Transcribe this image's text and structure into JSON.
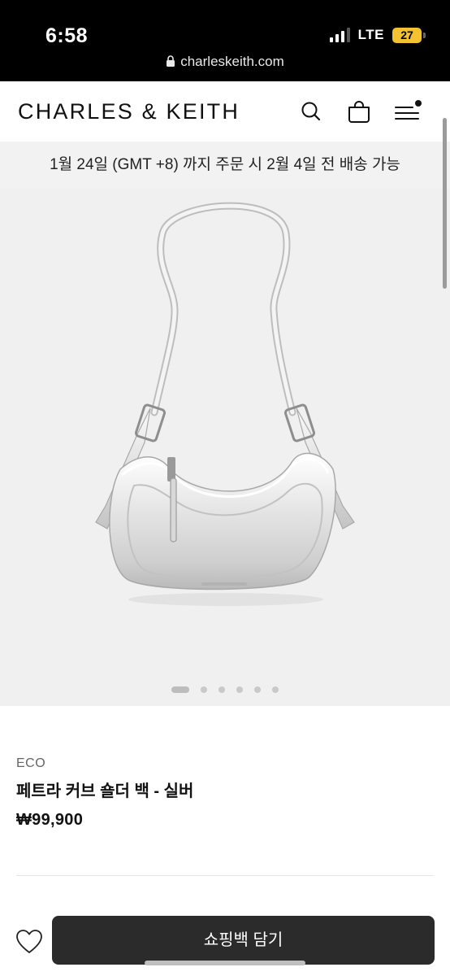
{
  "status_bar": {
    "time": "6:58",
    "network": "LTE",
    "battery": "27"
  },
  "browser": {
    "url": "charleskeith.com"
  },
  "header": {
    "brand": "CHARLES & KEITH",
    "icons": [
      "search-icon",
      "shopping-bag-icon",
      "menu-icon"
    ]
  },
  "delivery_banner": {
    "text": "1월 24일 (GMT +8) 까지 주문 시 2월 4일 전 배송 가능"
  },
  "gallery": {
    "image_count": 6,
    "active_index": 0
  },
  "product": {
    "tag": "ECO",
    "name": "페트라 커브 숄더 백 - 실버",
    "price": "₩99,900"
  },
  "actions": {
    "add_to_bag_label": "쇼핑백 담기",
    "wishlist_icon": "heart-icon"
  },
  "colors": {
    "status_bar_bg": "#000000",
    "banner_bg": "#f2f2f2",
    "gallery_bg": "#f0f0f0",
    "button_bg": "#2b2b2b",
    "battery": "#f2c230"
  }
}
